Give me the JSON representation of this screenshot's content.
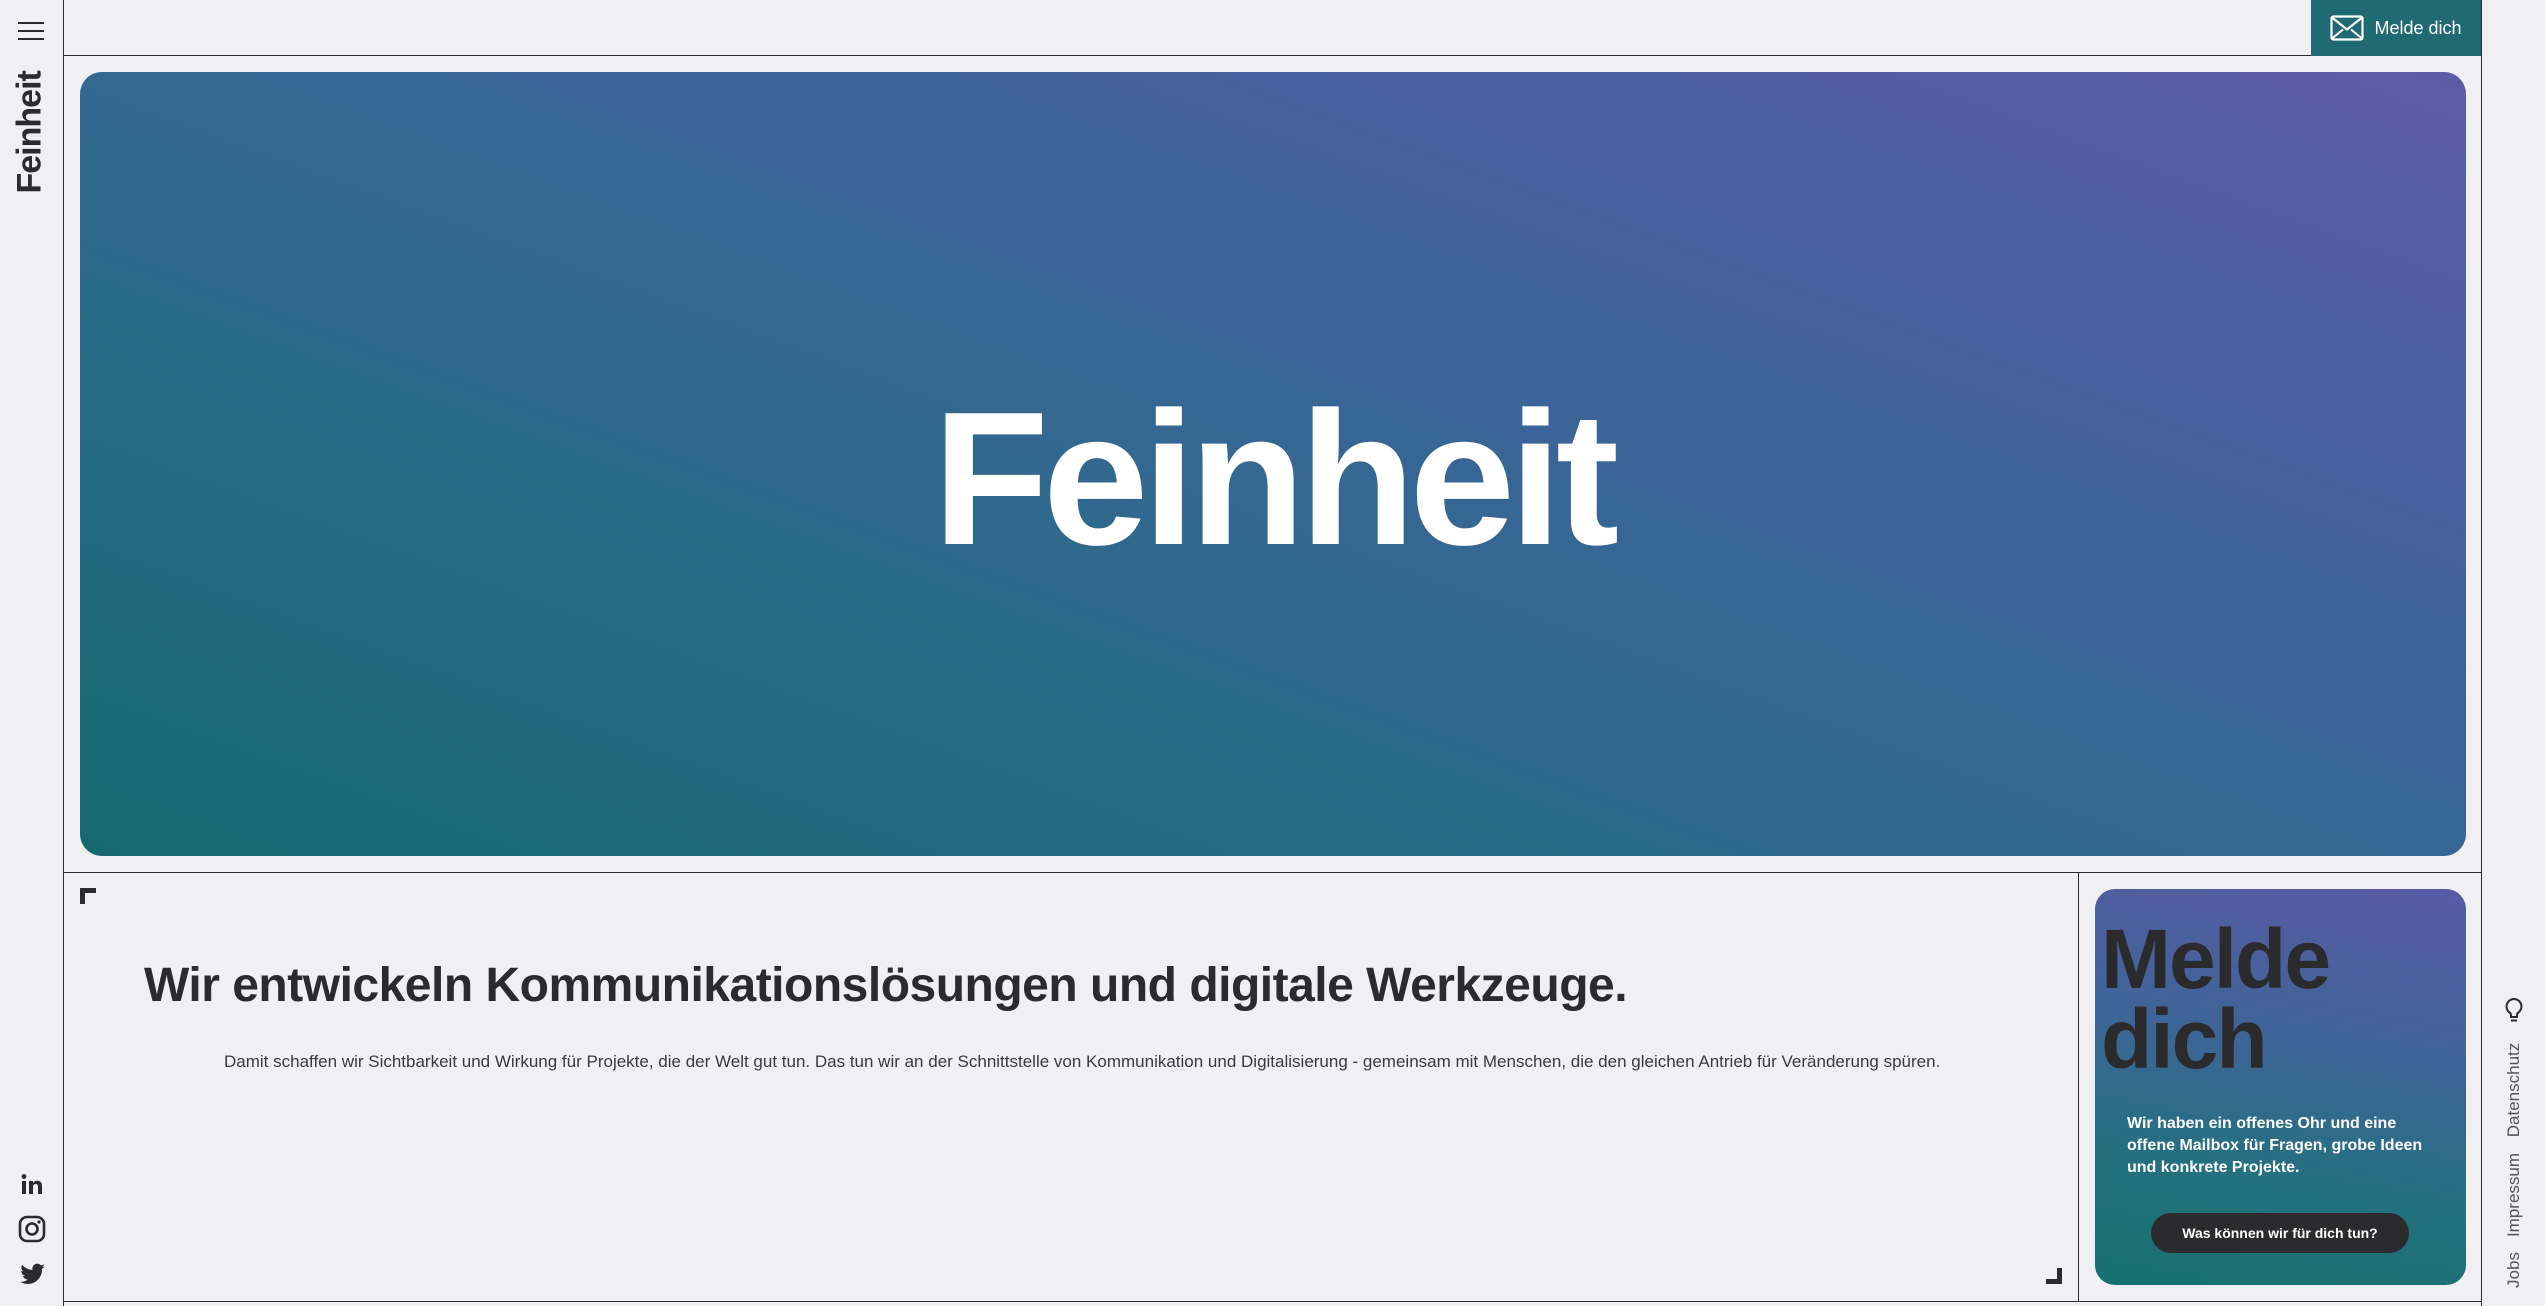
{
  "brand": {
    "name": "Feinheit"
  },
  "header": {
    "contact_label": "Melde dich"
  },
  "hero": {
    "title": "Feinheit"
  },
  "intro": {
    "heading": "Wir entwickeln Kommunikationslösungen und digitale Werkzeuge.",
    "text": "Damit schaffen wir Sichtbarkeit und Wirkung für Projekte, die der Welt gut tun. Das tun wir an der Schnittstelle von Kommunikation und Digitalisierung - gemeinsam mit Menschen, die den gleichen Antrieb für Veränderung spüren."
  },
  "cta": {
    "title_line1": "Melde",
    "title_line2": "dich",
    "text": "Wir haben ein offenes Ohr und eine offene Mailbox für Fragen, grobe Ideen und konkrete Projekte.",
    "button_label": "Was können wir für dich tun?"
  },
  "footer_links": [
    "Datenschutz",
    "Impressum",
    "Jobs"
  ],
  "icons": [
    "menu-icon",
    "mail-icon",
    "linkedin-icon",
    "instagram-icon",
    "twitter-icon",
    "lightbulb-icon"
  ],
  "colors": {
    "accent": "#1f6a73",
    "text": "#2b2b2d",
    "background": "#f0f0f3"
  }
}
